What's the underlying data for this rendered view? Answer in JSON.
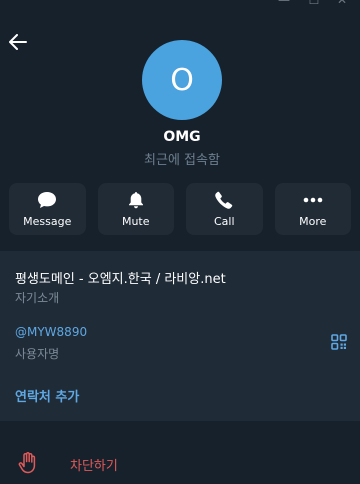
{
  "window": {
    "min_glyph": "—",
    "max_glyph": "☐",
    "close_glyph": "✕"
  },
  "header": {
    "back_icon": "arrow-left-icon"
  },
  "profile": {
    "avatar_letter": "O",
    "avatar_color": "#4aa3df",
    "name": "OMG",
    "status": "최근에 접속함"
  },
  "actions": [
    {
      "label": "Message",
      "icon": "chat-bubble-icon"
    },
    {
      "label": "Mute",
      "icon": "bell-icon"
    },
    {
      "label": "Call",
      "icon": "phone-icon"
    },
    {
      "label": "More",
      "icon": "more-dots-icon"
    }
  ],
  "info": {
    "bio_text": "평생도메인 - 오엠지.한국 / 라비앙.net",
    "bio_label": "자기소개",
    "username": "@MYW8890",
    "username_label": "사용자명",
    "add_contact": "연락처 추가"
  },
  "block": {
    "label": "차단하기",
    "color": "#e05a5a"
  }
}
